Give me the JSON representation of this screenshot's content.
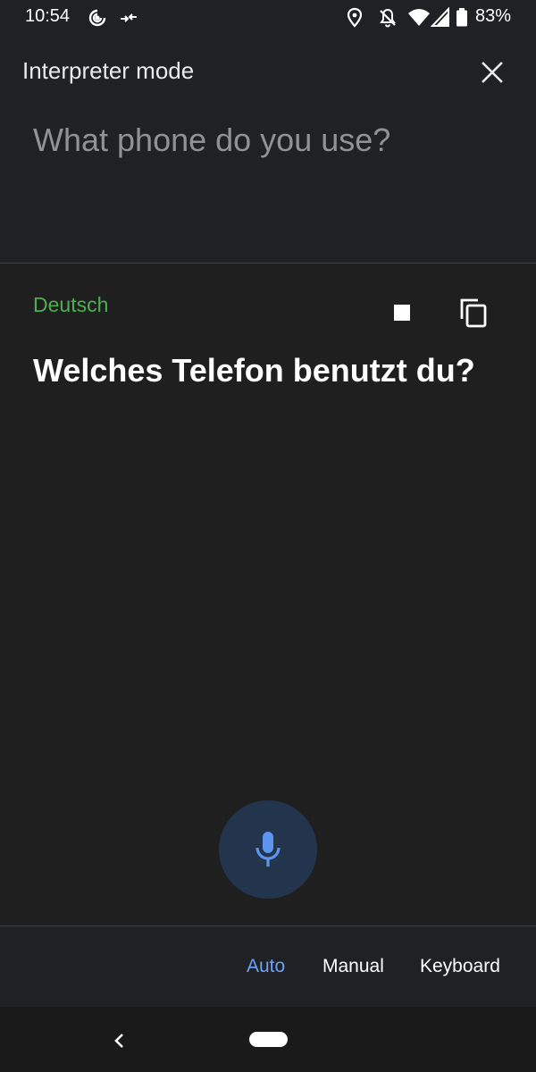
{
  "status_bar": {
    "time": "10:54",
    "battery": "83%",
    "icons": [
      "hotspot-icon",
      "data-transfer-icon",
      "location-icon",
      "notifications-off-icon",
      "wifi-icon",
      "cellular-signal-icon",
      "battery-icon"
    ]
  },
  "header": {
    "title": "Interpreter mode",
    "close_icon": "close-icon"
  },
  "source": {
    "text": "What phone do you use?"
  },
  "translation": {
    "language": "Deutsch",
    "text": "Welches Telefon benutzt du?",
    "stop_icon": "stop-icon",
    "copy_icon": "copy-icon"
  },
  "mic": {
    "icon": "microphone-icon"
  },
  "modes": {
    "auto": "Auto",
    "manual": "Manual",
    "keyboard": "Keyboard",
    "active": "Auto"
  },
  "colors": {
    "language_label": "#4caf50",
    "active_mode": "#6ea2f7",
    "mic_button": "#23344d",
    "mic_icon": "#5c95f0"
  },
  "nav_bar": {
    "back_icon": "back-chevron-icon",
    "home_icon": "home-pill-icon"
  }
}
